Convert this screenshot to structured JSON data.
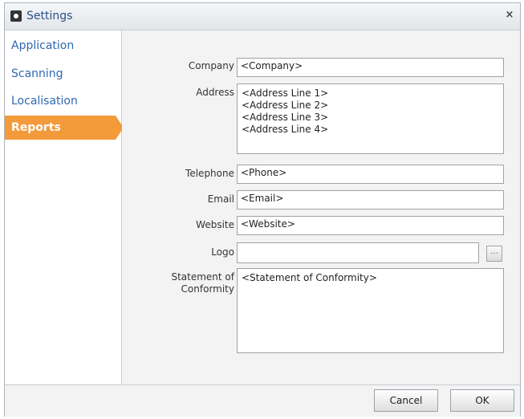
{
  "window": {
    "title": "Settings",
    "close_glyph": "×"
  },
  "sidebar": {
    "items": [
      {
        "label": "Application"
      },
      {
        "label": "Scanning"
      },
      {
        "label": "Localisation"
      },
      {
        "label": "Reports",
        "active": true
      }
    ]
  },
  "form": {
    "company": {
      "label": "Company",
      "value": "<Company>"
    },
    "address": {
      "label": "Address",
      "value": "<Address Line 1>\n<Address Line 2>\n<Address Line 3>\n<Address Line 4>"
    },
    "telephone": {
      "label": "Telephone",
      "value": "<Phone>"
    },
    "email": {
      "label": "Email",
      "value": "<Email>"
    },
    "website": {
      "label": "Website",
      "value": "<Website>"
    },
    "logo": {
      "label": "Logo",
      "value": "",
      "browse_label": "..."
    },
    "statement": {
      "label": "Statement of\nConformity",
      "value": "<Statement of Conformity>"
    }
  },
  "buttons": {
    "cancel": "Cancel",
    "ok": "OK"
  },
  "colors": {
    "accent": "#f39a3b",
    "link": "#2e69b0"
  }
}
